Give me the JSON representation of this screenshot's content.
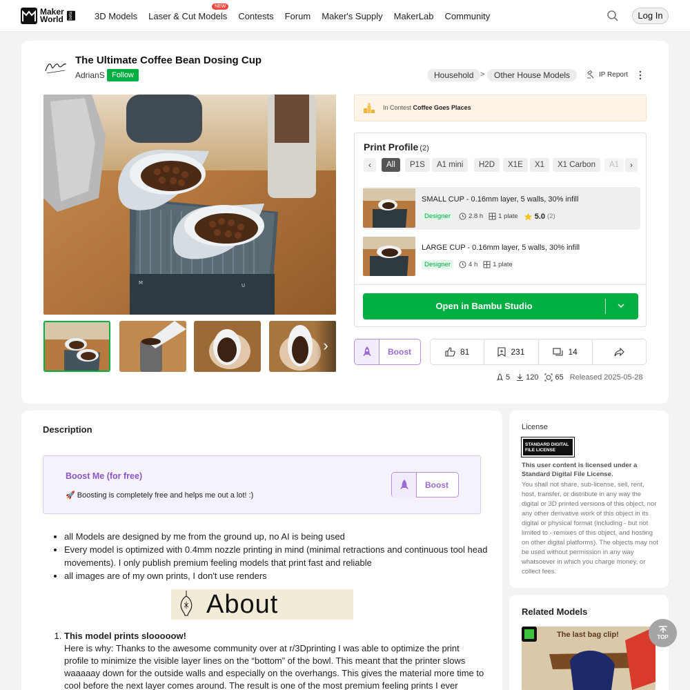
{
  "nav": {
    "logo_line1": "Maker",
    "logo_line2": "World",
    "logo_beta": "beta",
    "items": [
      {
        "label": "3D Models"
      },
      {
        "label": "Laser & Cut Models",
        "badge": "NEW"
      },
      {
        "label": "Contests"
      },
      {
        "label": "Forum"
      },
      {
        "label": "Maker's Supply"
      },
      {
        "label": "MakerLab"
      },
      {
        "label": "Community"
      }
    ],
    "login_label": "Log In",
    "search_icon": "search-icon"
  },
  "model": {
    "title": "The Ultimate Coffee Bean Dosing Cup",
    "author": "AdrianS",
    "avatar_text": "AdrianS",
    "follow_label": "Follow",
    "breadcrumb": [
      "Household",
      "Other House Models"
    ],
    "breadcrumb_sep": ">",
    "ip_report": "IP Report"
  },
  "contest": {
    "prefix": "In Contest",
    "name": "Coffee Goes Places"
  },
  "print_profile": {
    "title": "Print Profile",
    "count": "(2)",
    "tabs": [
      "All",
      "P1S",
      "A1 mini",
      "H2D",
      "X1E",
      "X1",
      "X1 Carbon",
      "A1"
    ],
    "active_tab": "All",
    "profiles": [
      {
        "name": "SMALL CUP - 0.16mm layer, 5 walls, 30% infill",
        "tag": "Designer",
        "time": "2.8 h",
        "plates": "1 plate",
        "rating": "5.0",
        "rating_count": "(2)"
      },
      {
        "name": "LARGE CUP - 0.16mm layer, 5 walls, 30% infill",
        "tag": "Designer",
        "time": "4 h",
        "plates": "1 plate"
      }
    ],
    "open_button": "Open in Bambu Studio"
  },
  "actions": {
    "boost_label": "Boost",
    "likes": "81",
    "collects": "231",
    "comments": "14"
  },
  "counts": {
    "boosts": "5",
    "downloads": "120",
    "prints": "65",
    "released": "Released 2025-05-28"
  },
  "description": {
    "heading": "Description",
    "boost_title": "Boost Me (for free)",
    "boost_text": "🚀 Boosting is completely free and helps me out a lot! :)",
    "boost_button": "Boost",
    "bullets": [
      "all Models are designed by me from the ground up, no AI is being used",
      "Every model is optimized with 0.4mm nozzle printing in mind (minimal retractions and continuous tool head movements). I only publish premium feeling models that print fast and reliable",
      "all images are of my own prints, I don't use renders"
    ],
    "about_heading": "About",
    "numbered_title": "This model prints slooooow!",
    "numbered_text": "Here is why: Thanks to the awesome community over at r/3Dprinting I was able to optimize the print profile to minimize the visible layer lines on the “bottom” of the bowl. This meant that the printer slows waaaaay down for the outside walls and especially on the overhangs. This gives the material more time to cool before the next layer comes around. The result is one of the most premium feeling prints I ever"
  },
  "license": {
    "label": "License",
    "badge": "STANDARD DIGITAL FILE LICENSE",
    "summary": "This user content is licensed under a Standard Digital File License.",
    "text": "You shall not share, sub-license, sell, rent, host, transfer, or distribute in any way the digital or 3D printed versions of this object, nor any other derivative work of this object in its digital or physical format (including - but not limited to - remixes of this object, and hosting on other digital platforms). The objects may not be used without permission in any way whatsoever in which you charge money, or collect fees."
  },
  "related": {
    "title": "Related Models",
    "caption": "The last bag clip!"
  },
  "top_button": "TOP",
  "colors": {
    "brand_green": "#00ae42",
    "boost_purple": "#9b6ad4"
  }
}
